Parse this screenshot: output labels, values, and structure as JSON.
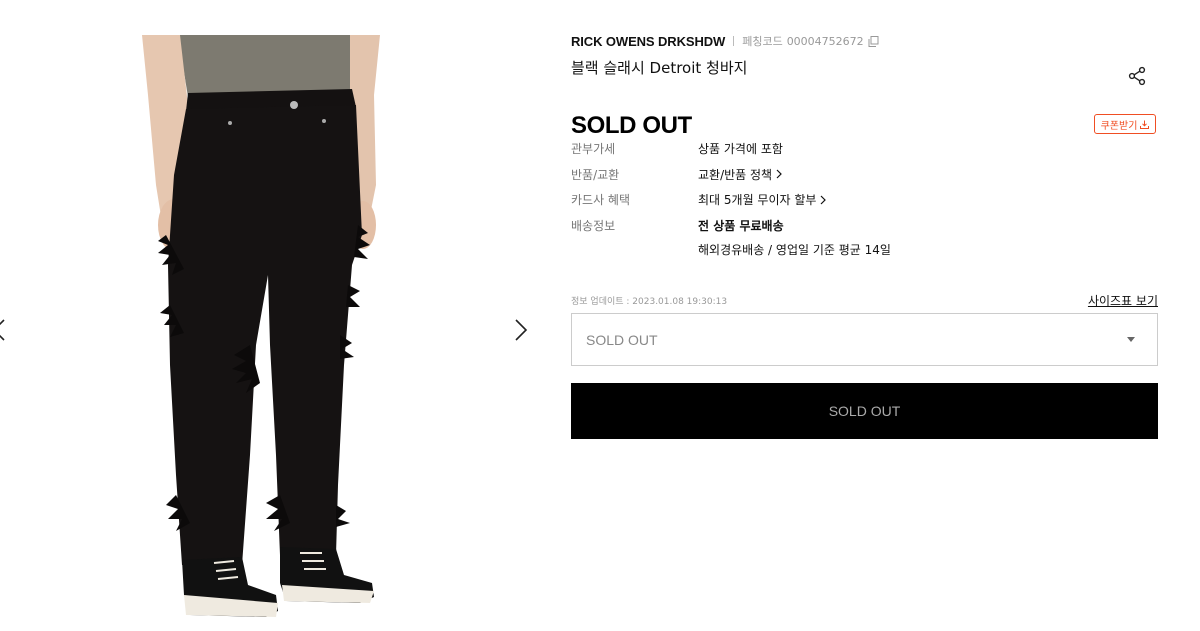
{
  "product": {
    "brand": "RICK OWENS DRKSHDW",
    "code_label": "페칭코드",
    "code": "00004752672",
    "name": "블랙 슬래시 Detroit 청바지",
    "price_status": "SOLD OUT",
    "coupon_label": "쿠폰받기"
  },
  "details": {
    "duty_label": "관부가세",
    "duty_value": "상품 가격에 포함",
    "return_label": "반품/교환",
    "return_value": "교환/반품 정책",
    "card_label": "카드사 혜택",
    "card_value": "최대 5개월 무이자 할부",
    "shipping_label": "배송정보",
    "shipping_line1": "전 상품 무료배송",
    "shipping_line2": "해외경유배송 / 영업일 기준 평균 14일"
  },
  "update_info": "정보 업데이트 : 2023.01.08 19:30:13",
  "size_chart_label": "사이즈표 보기",
  "size_select": {
    "selected": "SOLD OUT"
  },
  "buy_button_label": "SOLD OUT",
  "colors": {
    "accent": "#f04e23",
    "button_bg": "#000000"
  },
  "icons": [
    "chevron-left-icon",
    "chevron-right-icon",
    "copy-icon",
    "share-icon",
    "download-icon",
    "caret-down-icon"
  ]
}
